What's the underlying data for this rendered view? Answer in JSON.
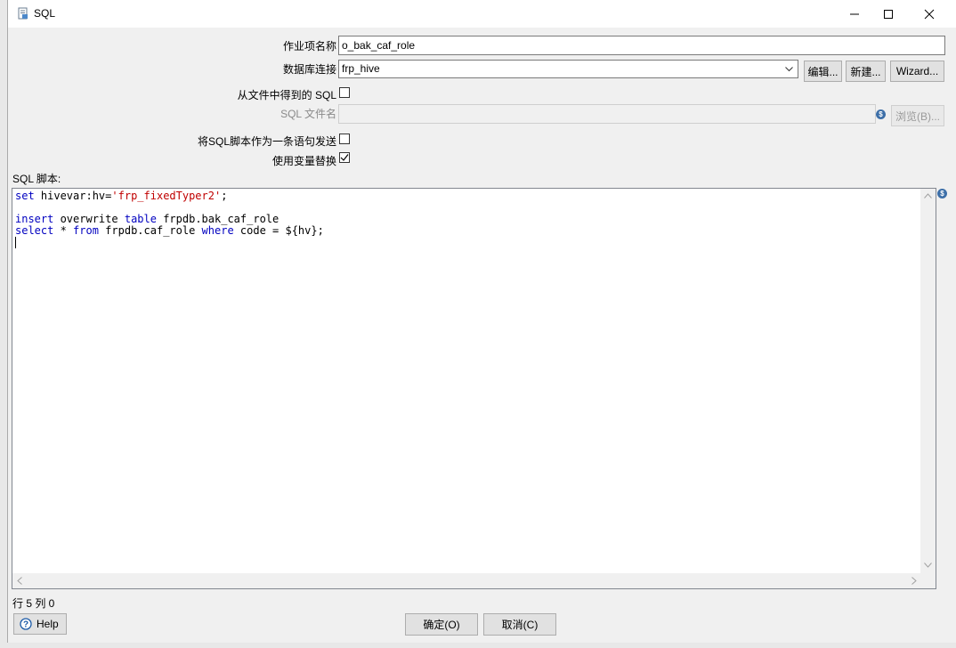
{
  "window": {
    "title": "SQL",
    "controls": {
      "minimize": "—",
      "maximize": "☐",
      "close": "✕"
    }
  },
  "form": {
    "job_name": {
      "label": "作业项名称",
      "value": "o_bak_caf_role"
    },
    "db_connection": {
      "label": "数据库连接",
      "value": "frp_hive",
      "edit_button": "编辑...",
      "new_button": "新建...",
      "wizard_button": "Wizard..."
    },
    "sql_from_file": {
      "label": "从文件中得到的 SQL",
      "checked": false
    },
    "sql_filename": {
      "label": "SQL 文件名",
      "value": "",
      "browse_button": "浏览(B)..."
    },
    "send_as_single": {
      "label": "将SQL脚本作为一条语句发送",
      "checked": false
    },
    "variable_substitution": {
      "label": "使用变量替换",
      "checked": true
    }
  },
  "script": {
    "label": "SQL 脚本:",
    "lines": [
      [
        {
          "t": "set",
          "c": "kw"
        },
        {
          "t": " hivevar:hv=",
          "c": ""
        },
        {
          "t": "'frp_fixedTyper2'",
          "c": "str"
        },
        {
          "t": ";",
          "c": ""
        }
      ],
      [],
      [
        {
          "t": "insert",
          "c": "kw"
        },
        {
          "t": " overwrite ",
          "c": ""
        },
        {
          "t": "table",
          "c": "kw"
        },
        {
          "t": " frpdb.bak_caf_role",
          "c": ""
        }
      ],
      [
        {
          "t": "select",
          "c": "kw"
        },
        {
          "t": " * ",
          "c": ""
        },
        {
          "t": "from",
          "c": "kw"
        },
        {
          "t": " frpdb.caf_role ",
          "c": ""
        },
        {
          "t": "where",
          "c": "kw"
        },
        {
          "t": " code = ${hv};",
          "c": ""
        }
      ],
      []
    ]
  },
  "status": {
    "position": "行 5 列 0"
  },
  "footer": {
    "help_button": "Help",
    "ok_button": "确定(O)",
    "cancel_button": "取消(C)"
  }
}
